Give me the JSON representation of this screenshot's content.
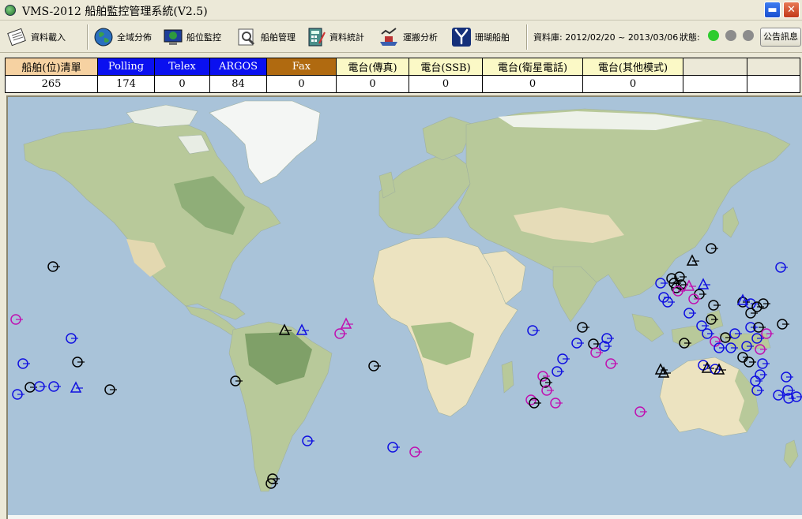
{
  "window": {
    "title": "VMS-2012 船舶監控管理系統(V2.5)",
    "minimize_glyph": "▬",
    "close_glyph": "✕"
  },
  "toolbar": {
    "buttons": [
      {
        "label": "資料載入",
        "icon": "data-load-icon"
      },
      {
        "label": "全域分佈",
        "icon": "globe-icon"
      },
      {
        "label": "船位監控",
        "icon": "monitor-globe-icon"
      },
      {
        "label": "船舶管理",
        "icon": "ship-magnifier-icon"
      },
      {
        "label": "資料統計",
        "icon": "calculator-icon"
      },
      {
        "label": "運搬分析",
        "icon": "ship-chart-icon"
      },
      {
        "label": "珊瑚船舶",
        "icon": "coral-icon"
      }
    ],
    "database_label": "資料庫: 2012/02/20 ~ 2013/03/06",
    "status_label": "狀態:",
    "status_lights": [
      "#2ecc2e",
      "#8c8c8c",
      "#8c8c8c"
    ],
    "notice_button": "公告訊息"
  },
  "stats": {
    "headers": [
      {
        "label": "船舶(位)清單",
        "bg": "#f6d2a2",
        "fg": "#000000"
      },
      {
        "label": "Polling",
        "bg": "#0a10f0",
        "fg": "#ffffff"
      },
      {
        "label": "Telex",
        "bg": "#0a10f0",
        "fg": "#ffffff"
      },
      {
        "label": "ARGOS",
        "bg": "#0a10f0",
        "fg": "#ffffff"
      },
      {
        "label": "Fax",
        "bg": "#b06a10",
        "fg": "#ffffff"
      },
      {
        "label": "電台(傳真)",
        "bg": "#fbf9c6",
        "fg": "#000000"
      },
      {
        "label": "電台(SSB)",
        "bg": "#fbf9c6",
        "fg": "#000000"
      },
      {
        "label": "電台(衛星電話)",
        "bg": "#fbf9c6",
        "fg": "#000000"
      },
      {
        "label": "電台(其他模式)",
        "bg": "#fbf9c6",
        "fg": "#000000"
      },
      {
        "label": "",
        "bg": "#ece9d8",
        "fg": "#000000"
      },
      {
        "label": "",
        "bg": "#ece9d8",
        "fg": "#000000"
      }
    ],
    "values": [
      "265",
      "174",
      "0",
      "84",
      "0",
      "0",
      "0",
      "0",
      "0",
      "",
      ""
    ]
  },
  "map": {
    "colors": {
      "ocean": "#a9c3d9",
      "land": "#b8c99a",
      "forest": "#8fae78",
      "desert": "#ece3c0",
      "ice": "#f4f6f4",
      "marker_black": "#000000",
      "marker_blue": "#1010e0",
      "marker_magenta": "#c010b0"
    },
    "vessel_groups": [
      {
        "status": "Polling",
        "marker_color": "blue"
      },
      {
        "status": "ARGOS",
        "marker_color": "black"
      },
      {
        "status": "other",
        "marker_color": "magenta"
      }
    ]
  }
}
